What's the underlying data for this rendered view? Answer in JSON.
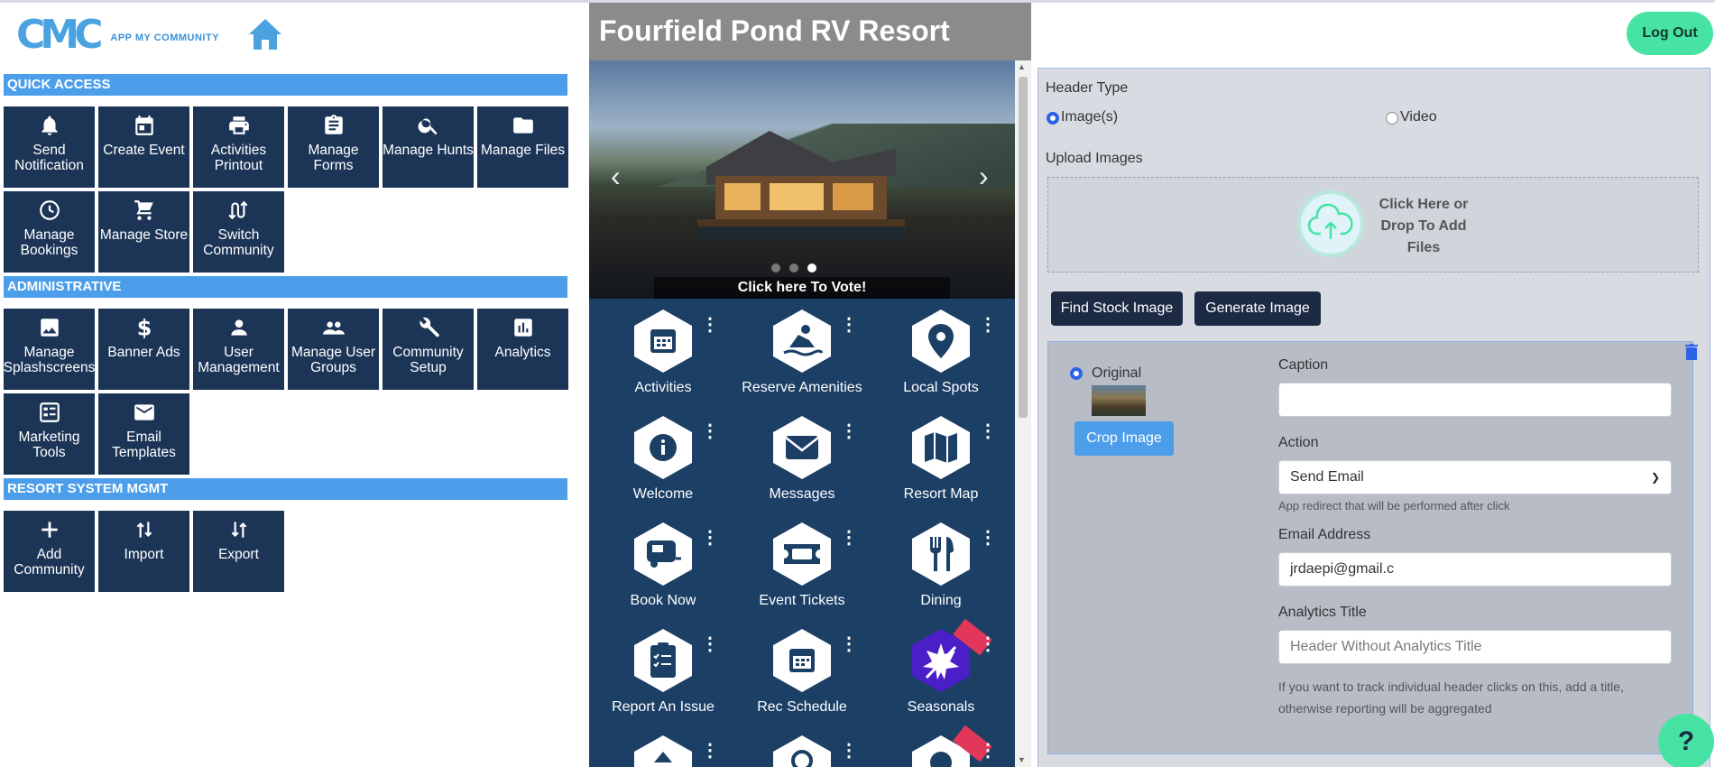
{
  "brand": {
    "logo_mark": "CMC",
    "logo_text": "APP MY COMMUNITY"
  },
  "sections": {
    "quick_access": "QUICK ACCESS",
    "administrative": "ADMINISTRATIVE",
    "resort_system": "RESORT SYSTEM MGMT"
  },
  "quick_access_tiles": [
    {
      "label": "Send Notification",
      "icon": "bell-icon"
    },
    {
      "label": "Create Event",
      "icon": "calendar-icon"
    },
    {
      "label": "Activities Printout",
      "icon": "printer-icon"
    },
    {
      "label": "Manage Forms",
      "icon": "clipboard-icon"
    },
    {
      "label": "Manage Hunts",
      "icon": "search-icon"
    },
    {
      "label": "Manage Files",
      "icon": "folder-icon"
    },
    {
      "label": "Manage Bookings",
      "icon": "clock-icon"
    },
    {
      "label": "Manage Store",
      "icon": "cart-icon"
    },
    {
      "label": "Switch Community",
      "icon": "switch-icon"
    }
  ],
  "administrative_tiles": [
    {
      "label": "Manage Splashscreens",
      "icon": "image-icon"
    },
    {
      "label": "Banner Ads",
      "icon": "dollar-icon"
    },
    {
      "label": "User Management",
      "icon": "user-icon"
    },
    {
      "label": "Manage User Groups",
      "icon": "users-icon"
    },
    {
      "label": "Community Setup",
      "icon": "wrench-icon"
    },
    {
      "label": "Analytics",
      "icon": "analytics-icon"
    },
    {
      "label": "Marketing Tools",
      "icon": "checklist-icon"
    },
    {
      "label": "Email Templates",
      "icon": "envelope-icon"
    }
  ],
  "resort_tiles": [
    {
      "label": "Add Community",
      "icon": "plus-icon"
    },
    {
      "label": "Import",
      "icon": "import-icon"
    },
    {
      "label": "Export",
      "icon": "export-icon"
    }
  ],
  "preview": {
    "title": "Fourfield Pond RV Resort",
    "vote_banner": "Click here To Vote!",
    "slides": 3,
    "active_slide": 3,
    "apps": [
      {
        "label": "Activities",
        "icon": "calendar-icon"
      },
      {
        "label": "Reserve Amenities",
        "icon": "boating-icon"
      },
      {
        "label": "Local Spots",
        "icon": "map-pin-icon"
      },
      {
        "label": "Welcome",
        "icon": "info-icon"
      },
      {
        "label": "Messages",
        "icon": "envelope-icon"
      },
      {
        "label": "Resort Map",
        "icon": "map-icon"
      },
      {
        "label": "Book Now",
        "icon": "rv-icon"
      },
      {
        "label": "Event Tickets",
        "icon": "ticket-icon"
      },
      {
        "label": "Dining",
        "icon": "utensils-icon"
      },
      {
        "label": "Report An Issue",
        "icon": "clipboard-check-icon"
      },
      {
        "label": "Rec Schedule",
        "icon": "calendar-icon"
      },
      {
        "label": "Seasonals",
        "icon": "seasonal-leaf-icon"
      }
    ],
    "more_symbol": "⋮"
  },
  "header": {
    "logout": "Log Out"
  },
  "editor": {
    "header_type_label": "Header Type",
    "header_type_options": [
      "Image(s)",
      "Video"
    ],
    "header_type_selected": "Image(s)",
    "upload_label": "Upload Images",
    "upload_text": "Click Here or Drop To Add Files",
    "find_stock": "Find Stock Image",
    "generate": "Generate Image",
    "image_card": {
      "original_label": "Original",
      "crop_button": "Crop Image",
      "caption_label": "Caption",
      "caption_value": "",
      "action_label": "Action",
      "action_value": "Send Email",
      "action_hint": "App redirect that will be performed after click",
      "email_label": "Email Address",
      "email_value": "jrdaepi@gmail.c",
      "analytics_label": "Analytics Title",
      "analytics_placeholder": "Header Without Analytics Title",
      "analytics_hint_1": "If you want to track individual header clicks on this, add a title,",
      "analytics_hint_2": "otherwise reporting will be aggregated"
    }
  },
  "help": "?",
  "colors": {
    "accent": "#4c9eea",
    "tile": "#1c3557",
    "app_bg": "#1c3f66",
    "green": "#46e3a4"
  }
}
